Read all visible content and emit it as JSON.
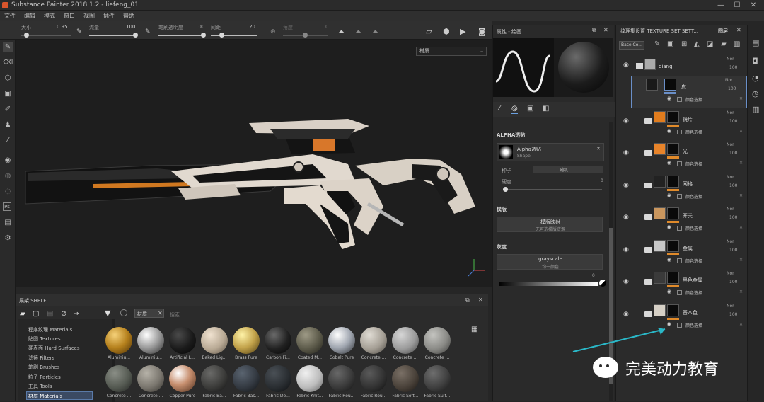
{
  "window": {
    "title": "Substance Painter 2018.1.2 - liefeng_01",
    "min": "—",
    "max": "☐",
    "close": "✕"
  },
  "menu": [
    "文件",
    "编辑",
    "模式",
    "窗口",
    "视图",
    "插件",
    "帮助"
  ],
  "toolbar": {
    "size_label": "大小",
    "size_value": "0.95",
    "flow_label": "流量",
    "flow_value": "100",
    "stroke_opacity_label": "笔刷透明度",
    "stroke_opacity_value": "100",
    "spacing_label": "间距",
    "spacing_value": "20",
    "angle_label": "角度",
    "angle_value": "0"
  },
  "viewport": {
    "material_select": "材质"
  },
  "properties": {
    "header": "属性 - 绘画",
    "alpha_section": "ALPHA透贴",
    "alpha_name": "Alpha透贴",
    "alpha_type": "Shape",
    "seed_label": "种子",
    "seed_value": "随机",
    "hardness_label": "硬度",
    "hardness_value": "0",
    "stencil_section": "模版",
    "stencil_button": "模版映射",
    "stencil_sub": "无可选模版资源",
    "grayscale_section": "灰度",
    "grayscale_name": "grayscale",
    "grayscale_sub": "均一颜色",
    "grayscale_value": "0"
  },
  "shelf": {
    "title": "展架 SHELF",
    "filter_tag": "材质",
    "search_placeholder": "搜索...",
    "categories": [
      "程序纹理 Materials",
      "贴图 Textures",
      "硬表面 Hard Surfaces",
      "滤镜 Filters",
      "笔刷 Brushes",
      "粒子 Particles",
      "工具 Tools",
      "材质 Materials"
    ],
    "materials_row1": [
      "Aluminiu...",
      "Aluminiu...",
      "Artificial L...",
      "Baked Lig...",
      "Brass Pure",
      "Carbon Fi...",
      "Coated M...",
      "Cobalt Pure",
      "Concrete ...",
      "Concrete ...",
      "Concrete ..."
    ],
    "materials_row2": [
      "Concrete ...",
      "Concrete ...",
      "Copper Pure",
      "Fabric Ba...",
      "Fabric Bas...",
      "Fabric De...",
      "Fabric Knit...",
      "Fabric Rou...",
      "Fabric Rou...",
      "Fabric Soft...",
      "Fabric Suit..."
    ]
  },
  "layers": {
    "tab_texture_set": "纹理集设置 TEXTURE SET SETT...",
    "tab_layers": "图层",
    "blend_select": "Base Co...",
    "group_name": "qiang",
    "items": [
      {
        "name": "皮",
        "blend": "Nor",
        "opacity": "100",
        "sub": "颜色选择",
        "color": "#1a1a1a"
      },
      {
        "name": "镜片",
        "blend": "Nor",
        "opacity": "100",
        "sub": "颜色选择",
        "color": "#e07c1e"
      },
      {
        "name": "光",
        "blend": "Nor",
        "opacity": "100",
        "sub": "颜色选择",
        "color": "#e8842a"
      },
      {
        "name": "网格",
        "blend": "Nor",
        "opacity": "100",
        "sub": "颜色选择",
        "color": "#222222"
      },
      {
        "name": "开关",
        "blend": "Nor",
        "opacity": "100",
        "sub": "颜色选择",
        "color": "#c9965e"
      },
      {
        "name": "金属",
        "blend": "Nor",
        "opacity": "100",
        "sub": "颜色选择",
        "color": "#c7c7c7"
      },
      {
        "name": "黑色金属",
        "blend": "Nor",
        "opacity": "100",
        "sub": "颜色选择",
        "color": "#3a3a3a"
      },
      {
        "name": "基本色",
        "blend": "Nor",
        "opacity": "100",
        "sub": "颜色选择",
        "color": "#d6d0c6"
      }
    ]
  },
  "watermark": {
    "text": "完美动力教育"
  }
}
